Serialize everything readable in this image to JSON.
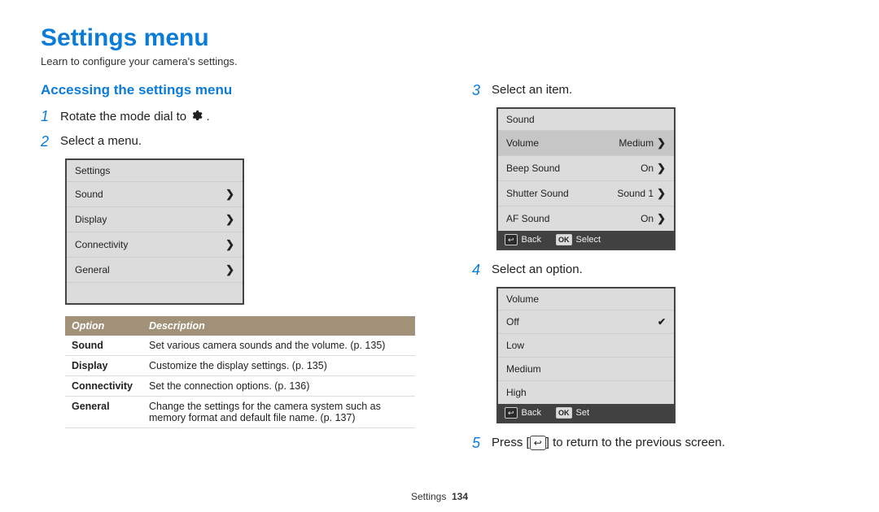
{
  "title": "Settings menu",
  "subtitle": "Learn to configure your camera's settings.",
  "left": {
    "heading": "Accessing the settings menu",
    "step1_before": "Rotate the mode dial to ",
    "step1_after": ".",
    "step2": "Select a menu.",
    "menu_panel": {
      "header": "Settings",
      "items": [
        "Sound",
        "Display",
        "Connectivity",
        "General"
      ]
    },
    "table": {
      "col1": "Option",
      "col2": "Description",
      "rows": [
        {
          "opt": "Sound",
          "desc": "Set various camera sounds and the volume. (p. 135)"
        },
        {
          "opt": "Display",
          "desc": "Customize the display settings. (p. 135)"
        },
        {
          "opt": "Connectivity",
          "desc": "Set the connection options. (p. 136)"
        },
        {
          "opt": "General",
          "desc": "Change the settings for the camera system such as memory format and default file name. (p. 137)"
        }
      ]
    }
  },
  "right": {
    "step3": "Select an item.",
    "item_panel": {
      "header": "Sound",
      "rows": [
        {
          "label": "Volume",
          "value": "Medium",
          "selected": true
        },
        {
          "label": "Beep Sound",
          "value": "On",
          "selected": false
        },
        {
          "label": "Shutter Sound",
          "value": "Sound 1",
          "selected": false
        },
        {
          "label": "AF Sound",
          "value": "On",
          "selected": false
        }
      ],
      "footer": {
        "back": "Back",
        "action": "Select"
      }
    },
    "step4": "Select an option.",
    "option_panel": {
      "header": "Volume",
      "rows": [
        {
          "label": "Off",
          "checked": true
        },
        {
          "label": "Low",
          "checked": false
        },
        {
          "label": "Medium",
          "checked": false
        },
        {
          "label": "High",
          "checked": false
        }
      ],
      "footer": {
        "back": "Back",
        "action": "Set"
      }
    },
    "step5_before": "Press [",
    "step5_after": "] to return to the previous screen."
  },
  "footer": {
    "section": "Settings",
    "page": "134"
  },
  "labels": {
    "ok": "OK"
  }
}
